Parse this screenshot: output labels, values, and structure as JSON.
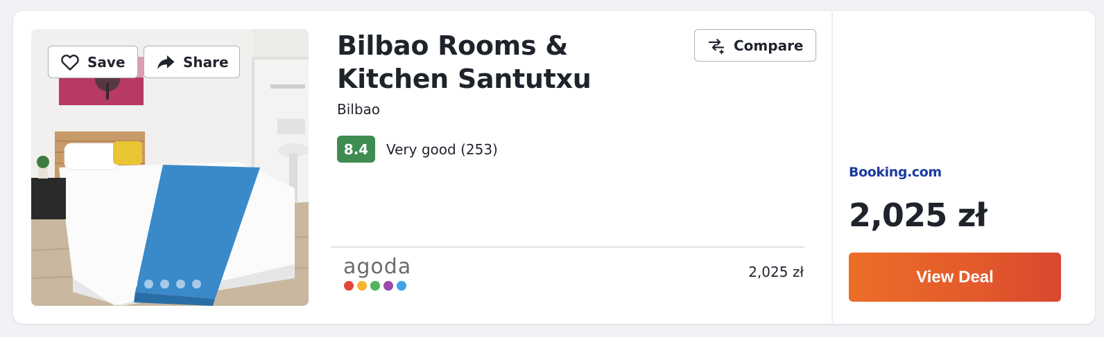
{
  "listing": {
    "name": "Bilbao Rooms & Kitchen Santutxu",
    "city": "Bilbao",
    "rating": {
      "score": "8.4",
      "label": "Very good (253)"
    }
  },
  "actions": {
    "save_label": "Save",
    "share_label": "Share",
    "compare_label": "Compare"
  },
  "gallery": {
    "image_count": 5,
    "active_index": 0
  },
  "offers": {
    "secondary": {
      "provider_logo_text": "agoda",
      "provider_logo_dot_colors": [
        "#e2463d",
        "#f7b532",
        "#52b35a",
        "#9b4aa6",
        "#3fa3e6"
      ],
      "price": "2,025 zł"
    },
    "primary": {
      "provider": "Booking.com",
      "price": "2,025 zł",
      "cta_label": "View Deal"
    }
  },
  "colors": {
    "rating_badge": "#3f8c52",
    "cta_gradient_start": "#ec6d28",
    "cta_gradient_end": "#d9472f",
    "booking_blue": "#1a3b9e"
  }
}
